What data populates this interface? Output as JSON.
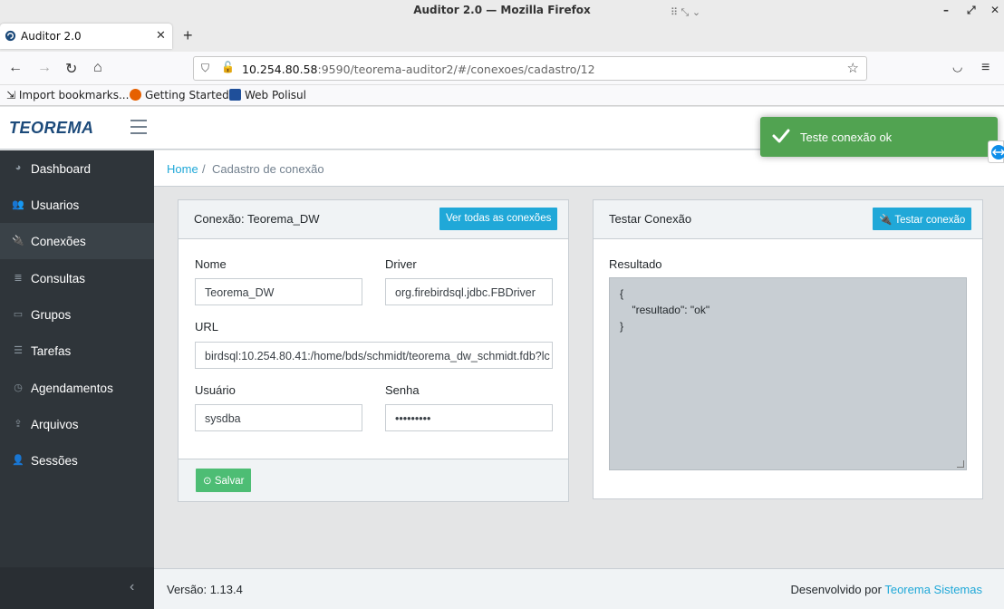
{
  "window": {
    "title": "Auditor 2.0 — Mozilla Firefox"
  },
  "browser": {
    "tab_title": "Auditor 2.0",
    "url_host": "10.254.80.58",
    "url_rest": ":9590/teorema-auditor2/#/conexoes/cadastro/12",
    "bookmarks": [
      "Import bookmarks...",
      "Getting Started",
      "Web Polisul"
    ]
  },
  "app": {
    "logo": "TEOREMA",
    "sidebar": [
      {
        "label": "Dashboard",
        "icon": "dashboard-icon"
      },
      {
        "label": "Usuarios",
        "icon": "users-icon"
      },
      {
        "label": "Conexões",
        "icon": "plug-icon"
      },
      {
        "label": "Consultas",
        "icon": "database-icon"
      },
      {
        "label": "Grupos",
        "icon": "folder-icon"
      },
      {
        "label": "Tarefas",
        "icon": "list-icon"
      },
      {
        "label": "Agendamentos",
        "icon": "clock-icon"
      },
      {
        "label": "Arquivos",
        "icon": "upload-icon"
      },
      {
        "label": "Sessões",
        "icon": "user-icon"
      }
    ],
    "breadcrumb": {
      "home": "Home",
      "separator": "/",
      "current": "Cadastro de conexão"
    },
    "connection_card": {
      "title": "Conexão: Teorema_DW",
      "view_all_button": "Ver todas as conexões",
      "nome_label": "Nome",
      "nome_value": "Teorema_DW",
      "driver_label": "Driver",
      "driver_value": "org.firebirdsql.jdbc.FBDriver",
      "url_label": "URL",
      "url_value": "birdsql:10.254.80.41:/home/bds/schmidt/teorema_dw_schmidt.fdb?lc",
      "usuario_label": "Usuário",
      "usuario_value": "sysdba",
      "senha_label": "Senha",
      "senha_value": "•••••••••",
      "save_button": "Salvar"
    },
    "test_card": {
      "title": "Testar Conexão",
      "test_button": "Testar conexão",
      "resultado_label": "Resultado",
      "resultado_value": "{\n    \"resultado\": \"ok\"\n}"
    },
    "footer": {
      "version": "Versão: 1.13.4",
      "developed_by": "Desenvolvido por",
      "company": "Teorema Sistemas"
    },
    "toast": {
      "message": "Teste conexão ok",
      "color": "#51a351"
    }
  }
}
